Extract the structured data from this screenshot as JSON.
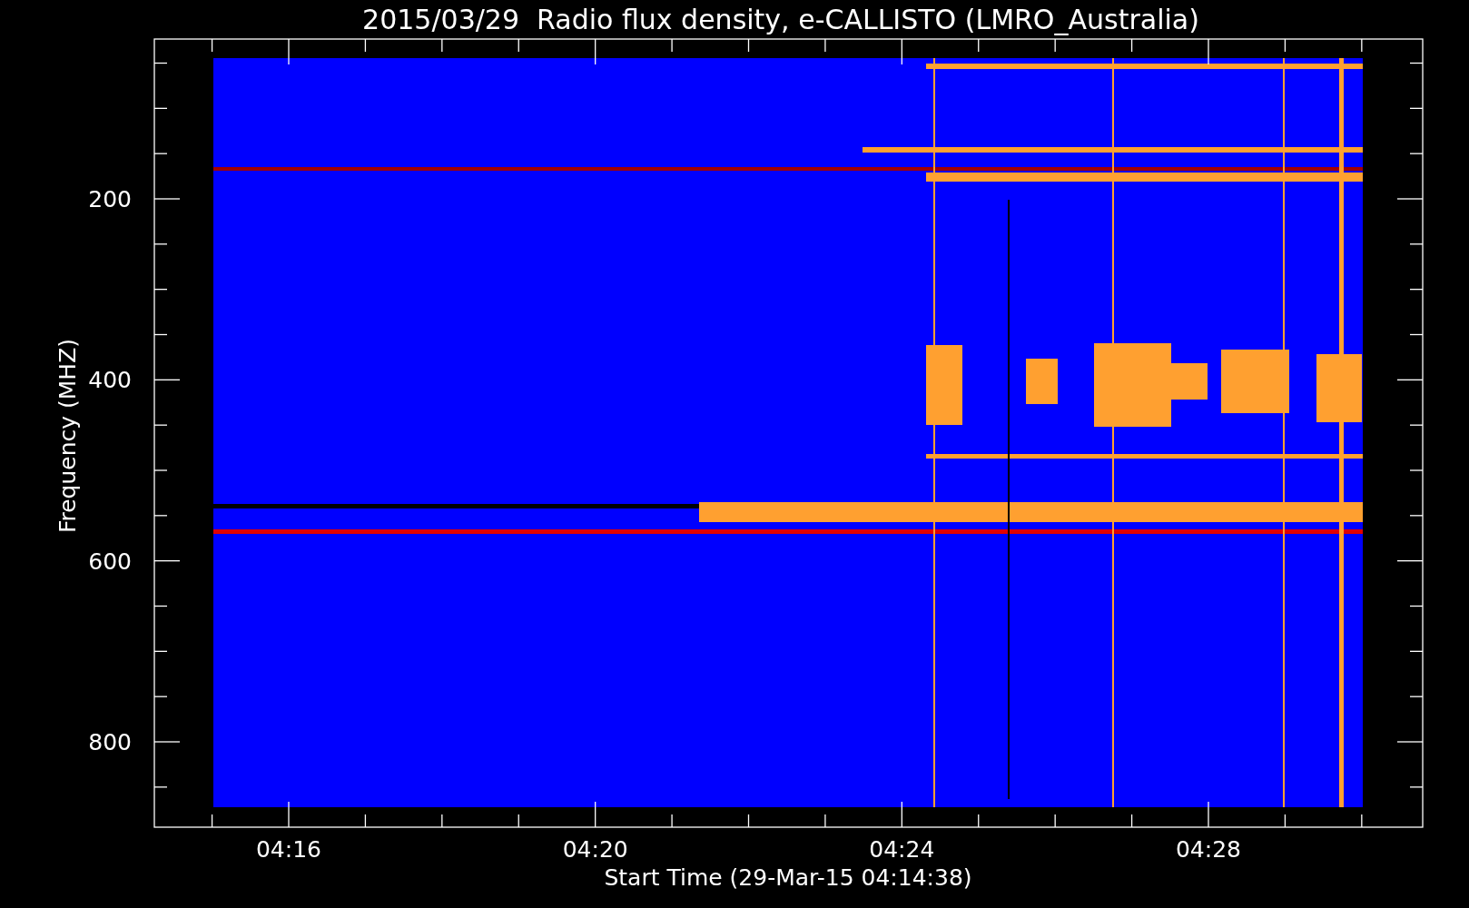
{
  "chart": {
    "title": "2015/03/29  Radio flux density, e-CALLISTO (LMRO_Australia)",
    "xlabel": "Start Time (29-Mar-15 04:14:38)",
    "ylabel": "Frequency (MHZ)",
    "yticks": [
      "200",
      "400",
      "600",
      "800"
    ],
    "xticks": [
      "04:16",
      "04:20",
      "04:24",
      "04:28"
    ]
  }
}
